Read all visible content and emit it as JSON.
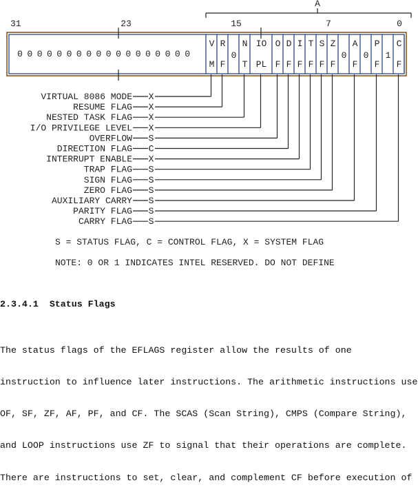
{
  "diagram": {
    "group_label": "A",
    "bit_numbers": [
      "31",
      "23",
      "15",
      "7",
      "0"
    ],
    "reserved_zero": "0",
    "reserved_zero_count": 18,
    "cells": [
      {
        "top": "V",
        "bottom": "M"
      },
      {
        "top": "R",
        "bottom": "F"
      },
      {
        "middle": "0"
      },
      {
        "top": "N",
        "bottom": "T"
      },
      {
        "top": "IO",
        "bottom": "PL"
      },
      {
        "top": "O",
        "bottom": "F"
      },
      {
        "top": "D",
        "bottom": "F"
      },
      {
        "top": "I",
        "bottom": "F"
      },
      {
        "top": "T",
        "bottom": "F"
      },
      {
        "top": "S",
        "bottom": "F"
      },
      {
        "top": "Z",
        "bottom": "F"
      },
      {
        "middle": "0"
      },
      {
        "top": "A",
        "bottom": "F"
      },
      {
        "middle": "0"
      },
      {
        "top": "P",
        "bottom": "F"
      },
      {
        "middle": "1"
      },
      {
        "top": "C",
        "bottom": "F"
      }
    ],
    "flags": [
      {
        "name": "VIRTUAL 8086 MODE",
        "type": "X",
        "cell": 0
      },
      {
        "name": "RESUME FLAG",
        "type": "X",
        "cell": 1
      },
      {
        "name": "NESTED TASK FLAG",
        "type": "X",
        "cell": 3
      },
      {
        "name": "I/O PRIVILEGE LEVEL",
        "type": "X",
        "cell": 4
      },
      {
        "name": "OVERFLOW",
        "type": "S",
        "cell": 5
      },
      {
        "name": "DIRECTION FLAG",
        "type": "C",
        "cell": 6
      },
      {
        "name": "INTERRUPT ENABLE",
        "type": "X",
        "cell": 7
      },
      {
        "name": "TRAP FLAG",
        "type": "S",
        "cell": 8
      },
      {
        "name": "SIGN FLAG",
        "type": "S",
        "cell": 9
      },
      {
        "name": "ZERO FLAG",
        "type": "S",
        "cell": 10
      },
      {
        "name": "AUXILIARY CARRY",
        "type": "S",
        "cell": 12
      },
      {
        "name": "PARITY FLAG",
        "type": "S",
        "cell": 14
      },
      {
        "name": "CARRY FLAG",
        "type": "S",
        "cell": 16
      }
    ],
    "legend": "S = STATUS FLAG, C = CONTROL FLAG, X = SYSTEM FLAG",
    "note": "NOTE: 0 OR 1 INDICATES INTEL RESERVED. DO NOT DEFINE"
  },
  "section": {
    "heading": "2.3.4.1  Status Flags",
    "paragraph_lines": [
      "The status flags of the EFLAGS register allow the results of one",
      "instruction to influence later instructions. The arithmetic instructions use",
      "OF, SF, ZF, AF, PF, and CF. The SCAS (Scan String), CMPS (Compare String),",
      "and LOOP instructions use ZF to signal that their operations are complete.",
      "There are instructions to set, clear, and complement CF before execution of"
    ]
  }
}
